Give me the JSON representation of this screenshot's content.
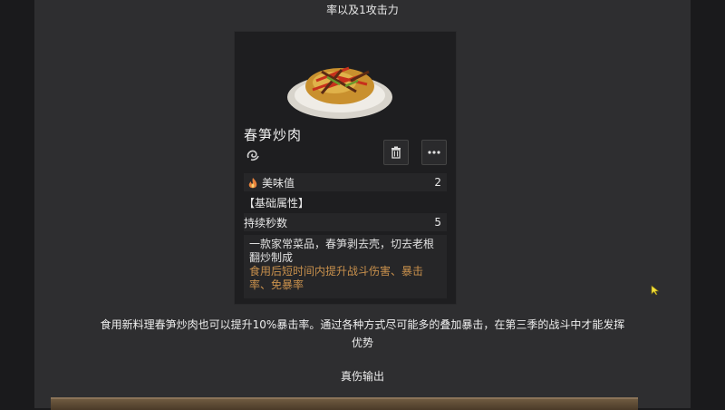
{
  "article": {
    "top_text": "率以及1攻击力",
    "body_line1": "食用新料理春笋炒肉也可以提升10%暴击率。通过各种方式尽可能多的叠加暴击，在第三季的战斗中才能发挥",
    "body_line2": "优势",
    "subhead": "真伤输出"
  },
  "item_card": {
    "name": "春笋炒肉",
    "type_icon": "swirl-icon",
    "buttons": {
      "delete_icon": "trash-icon",
      "more_icon": "more-dots-icon"
    },
    "flavor": {
      "label": "美味值",
      "value": "2"
    },
    "base_attr_label": "【基础属性】",
    "duration": {
      "label": "持续秒数",
      "value": "5"
    },
    "description": "一款家常菜品，春笋剥去壳，切去老根翻炒制成",
    "effect": "食用后短时间内提升战斗伤害、暴击率、免暴率"
  },
  "colors": {
    "page_bg": "#2e2e30",
    "outer_bg": "#1a1a1c",
    "card_bg": "#1e1e20",
    "effect_text": "#c8904c"
  }
}
